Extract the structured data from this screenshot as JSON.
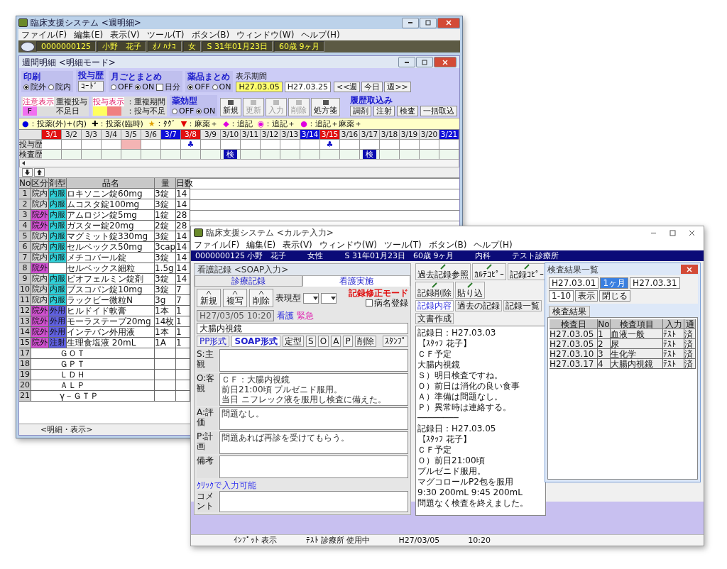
{
  "back_window": {
    "title": "臨床支援システム <週明細>",
    "menu": [
      "ファイル(F)",
      "編集(E)",
      "表示(V)",
      "ツール(T)",
      "ボタン(B)",
      "ウィンドウ(W)",
      "ヘルプ(H)"
    ],
    "patient_bar": [
      "0000000125",
      "小野　花子",
      "ｵﾉ ﾊﾅｺ",
      "女",
      "S 31年01月23日",
      "60歳 9ヶ月"
    ],
    "sub_window": {
      "title": "週間明細 <明細モード>",
      "print_group": {
        "heading": "印刷",
        "options": [
          {
            "label": "院外",
            "selected": true
          },
          {
            "label": "院内",
            "selected": false
          }
        ]
      },
      "dose_group": {
        "heading": "投与歴",
        "button": "ｺｰﾄﾞ"
      },
      "month_group": {
        "heading": "月ごとまとめ",
        "options": [
          {
            "label": "OFF",
            "selected": false
          },
          {
            "label": "ON",
            "selected": true
          }
        ],
        "check": {
          "label": "日分",
          "checked": false
        }
      },
      "drug_group": {
        "heading": "薬品まとめ",
        "options": [
          {
            "label": "OFF",
            "selected": true
          },
          {
            "label": "ON",
            "selected": false
          }
        ]
      },
      "type_group": {
        "heading": "薬効型",
        "options": [
          {
            "label": "OFF",
            "selected": false
          },
          {
            "label": "ON",
            "selected": true
          }
        ]
      },
      "notes": [
        {
          "tag": "注意表示",
          "lines": [
            "重複投与",
            "不足日"
          ],
          "swatches": [
            {
              "label": "F",
              "color": "#f070f0"
            }
          ]
        },
        {
          "tag": "投与表示",
          "lines": [
            "：重複期間",
            "：投与不足"
          ],
          "swatches": [
            {
              "color": "#ffff60"
            },
            {
              "color": "#f08080"
            }
          ]
        }
      ],
      "period": {
        "label": "表示期間",
        "from": "H27.03.05",
        "to": "H27.03.25",
        "nav": [
          "<<週",
          "今日",
          "週>>"
        ]
      },
      "tools": [
        {
          "label": "新規",
          "disabled": false
        },
        {
          "label": "更新",
          "disabled": true
        },
        {
          "label": "入力",
          "disabled": true
        },
        {
          "label": "削除",
          "disabled": true
        },
        {
          "label": "処方箋",
          "disabled": false
        }
      ],
      "history": {
        "heading": "履歴取込み",
        "buttons": [
          "調剤",
          "注射",
          "検査"
        ],
        "all": "一括取込"
      },
      "legend": [
        {
          "symbol": "●",
          "text": "：投薬(外)+(内)",
          "color": "#0000e0"
        },
        {
          "symbol": "✚",
          "text": "：投薬(臨時)",
          "color": "#000000"
        },
        {
          "symbol": "★",
          "text": "：ﾀｸﾞ",
          "color": "#e0a000"
        },
        {
          "symbol": "▼",
          "text": "：麻薬＋",
          "color": "#e00000"
        },
        {
          "symbol": "◆",
          "text": "：追記",
          "color": "#e000e0"
        },
        {
          "symbol": "◉",
          "text": "：追記＋",
          "color": "#e000e0"
        },
        {
          "symbol": "●",
          "text": "：追記＋麻薬＋",
          "color": "#e000e0"
        }
      ],
      "row_labels": [
        "投与歴",
        "検査歴"
      ],
      "days": [
        {
          "label": "3/1",
          "kind": "sun",
          "selected": false
        },
        {
          "label": "3/2",
          "kind": "day",
          "selected": false
        },
        {
          "label": "3/3",
          "kind": "day",
          "selected": false
        },
        {
          "label": "3/4",
          "kind": "day",
          "selected": false
        },
        {
          "label": "3/5",
          "kind": "day",
          "selected": true
        },
        {
          "label": "3/6",
          "kind": "day",
          "selected": false
        },
        {
          "label": "3/7",
          "kind": "sat",
          "selected": false
        },
        {
          "label": "3/8",
          "kind": "sun",
          "selected": false,
          "dose": "♣"
        },
        {
          "label": "3/9",
          "kind": "day",
          "selected": false
        },
        {
          "label": "3/10",
          "kind": "day",
          "selected": false,
          "lab": "検"
        },
        {
          "label": "3/11",
          "kind": "day",
          "selected": false
        },
        {
          "label": "3/12",
          "kind": "day",
          "selected": false
        },
        {
          "label": "3/13",
          "kind": "day",
          "selected": false
        },
        {
          "label": "3/14",
          "kind": "sat",
          "selected": false
        },
        {
          "label": "3/15",
          "kind": "sun",
          "selected": false,
          "dose": "♣"
        },
        {
          "label": "3/16",
          "kind": "day",
          "selected": false
        },
        {
          "label": "3/17",
          "kind": "day",
          "selected": false,
          "lab": "検"
        },
        {
          "label": "3/18",
          "kind": "day",
          "selected": false
        },
        {
          "label": "3/19",
          "kind": "day",
          "selected": false
        },
        {
          "label": "3/20",
          "kind": "day",
          "selected": false
        },
        {
          "label": "3/21",
          "kind": "sat",
          "selected": false
        }
      ],
      "columns": [
        "No",
        "区分",
        "剤型",
        "品名",
        "量",
        "日数"
      ],
      "rows": [
        {
          "no": "1",
          "division": {
            "label": "院内",
            "color": "#d8d8d8"
          },
          "form": {
            "label": "内服",
            "color": "#30d0d8"
          },
          "name": "ロキソニン錠60mg",
          "amount": "3錠",
          "days": "14"
        },
        {
          "no": "2",
          "division": {
            "label": "院内",
            "color": "#d8d8d8"
          },
          "form": {
            "label": "内服",
            "color": "#30d0d8"
          },
          "name": "ムコスタ錠100mg",
          "amount": "3錠",
          "days": "14"
        },
        {
          "no": "3",
          "division": {
            "label": "院外",
            "color": "#d050d0"
          },
          "form": {
            "label": "内服",
            "color": "#30d0d8"
          },
          "name": "アムロジン錠5mg",
          "amount": "1錠",
          "days": "28"
        },
        {
          "no": "4",
          "division": {
            "label": "院外",
            "color": "#d050d0"
          },
          "form": {
            "label": "内服",
            "color": "#30d0d8"
          },
          "name": "ガスター錠20mg",
          "amount": "2錠",
          "days": "28"
        },
        {
          "no": "5",
          "division": {
            "label": "院内",
            "color": "#d8d8d8"
          },
          "form": {
            "label": "内服",
            "color": "#30d0d8"
          },
          "name": "マグミット錠330mg",
          "amount": "3錠",
          "days": "14"
        },
        {
          "no": "6",
          "division": {
            "label": "院内",
            "color": "#d8d8d8"
          },
          "form": {
            "label": "内服",
            "color": "#30d0d8"
          },
          "name": "セルベックス50mg",
          "amount": "3cap",
          "days": "14"
        },
        {
          "no": "7",
          "division": {
            "label": "院内",
            "color": "#d8d8d8"
          },
          "form": {
            "label": "内服",
            "color": "#30d0d8"
          },
          "name": "メチコバール錠",
          "amount": "3錠",
          "days": "14"
        },
        {
          "no": "8",
          "division": {
            "label": "院外",
            "color": "#d050d0"
          },
          "name": "セルベックス細粒",
          "amount": "1.5g",
          "days": "14"
        },
        {
          "no": "9",
          "division": {
            "label": "院内",
            "color": "#d8d8d8"
          },
          "form": {
            "label": "内服",
            "color": "#30d0d8"
          },
          "name": "ビオフェルミン錠剤",
          "amount": "3錠",
          "days": "14"
        },
        {
          "no": "10",
          "division": {
            "label": "院内",
            "color": "#d8d8d8"
          },
          "form": {
            "label": "内服",
            "color": "#30d0d8"
          },
          "name": "ブスコパン錠10mg",
          "amount": "3錠",
          "days": "7"
        },
        {
          "no": "11",
          "division": {
            "label": "院内",
            "color": "#d8d8d8"
          },
          "form": {
            "label": "内服",
            "color": "#30d0d8"
          },
          "name": "ラックビー微粒N",
          "amount": "3g",
          "days": "7"
        },
        {
          "no": "12",
          "division": {
            "label": "院外",
            "color": "#d050d0"
          },
          "form": {
            "label": "外用",
            "color": "#6060e0"
          },
          "name": "ヒルドイド軟膏",
          "amount": "1本",
          "days": "1"
        },
        {
          "no": "13",
          "division": {
            "label": "院外",
            "color": "#d050d0"
          },
          "form": {
            "label": "外用",
            "color": "#6060e0"
          },
          "name": "モーラステープ20mg",
          "amount": "14枚",
          "days": "1"
        },
        {
          "no": "14",
          "division": {
            "label": "院外",
            "color": "#d050d0"
          },
          "form": {
            "label": "外用",
            "color": "#6060e0"
          },
          "name": "インテバン外用液",
          "amount": "1本",
          "days": "1"
        },
        {
          "no": "15",
          "division": {
            "label": "院外",
            "color": "#d050d0"
          },
          "form": {
            "label": "注射",
            "color": "#6060e0"
          },
          "name": "生理食塩液 20mL",
          "amount": "1A",
          "days": "1"
        }
      ],
      "lab_rows": [
        {
          "no": "17",
          "name": "ＧＯＴ"
        },
        {
          "no": "18",
          "name": "ＧＰＴ"
        },
        {
          "no": "19",
          "name": "ＬＤＨ"
        },
        {
          "no": "20",
          "name": "ＡＬＰ"
        },
        {
          "no": "21",
          "name": "γ－ＧＴＰ"
        }
      ],
      "status": "<明細・表示>"
    }
  },
  "front_window": {
    "title": "臨床支援システム <カルテ入力>",
    "menu": [
      "ファイル(F)",
      "編集(E)",
      "表示(V)",
      "ウィンドウ(W)",
      "ツール(T)",
      "ボタン(B)",
      "ヘルプ(H)"
    ],
    "patient_bar": [
      "0000000125 小野　花子",
      "女性",
      "S 31年01月23日　60歳 9ヶ月",
      "内科",
      "テスト診療所"
    ],
    "editor": {
      "title": "看護記録 <SOAP入力>",
      "tabs": [
        {
          "label": "診療記録",
          "selected": false
        },
        {
          "label": "看護実施",
          "selected": true
        }
      ],
      "buttons": [
        "新規",
        "複写",
        "削除"
      ],
      "type_label": "表現型",
      "mode_label": "記録修正モード",
      "register": {
        "label": "病名登録",
        "checked": false
      },
      "datetime": "H27/03/05 10:20",
      "staff": "看護",
      "urgent": "緊急",
      "problem": "大腸内視鏡",
      "formats": [
        {
          "label": "PP形式",
          "selected": false
        },
        {
          "label": "SOAP形式",
          "selected": true
        }
      ],
      "format_buttons": [
        "定型",
        "S",
        "O",
        "A",
        "P",
        "削除"
      ],
      "stamp": "ｽﾀﾝﾌﾟ",
      "sections": [
        {
          "label": "S:主観"
        },
        {
          "label": "O:客観",
          "lines": [
            "ＣＦ：大腸内視鏡",
            "前日21:00頃 プルゼニド服用。",
            "当日 ニフレック液を服用し検査に備えた。"
          ]
        },
        {
          "label": "A:評価",
          "lines": [
            "問題なし。"
          ]
        },
        {
          "label": "P:計画",
          "lines": [
            "問題あれば再診を受けてもらう。"
          ]
        },
        {
          "label": "備考"
        }
      ],
      "comment_hint": "ｸﾘｯｸで入力可能",
      "comment_label": "コメント"
    },
    "log": {
      "tools": [
        "過去記録参照",
        "ｶﾙﾃｺﾋﾟｰ",
        "記録ｺﾋﾟｰ",
        "記録削除",
        "貼り込"
      ],
      "tabs": [
        {
          "label": "記録内容",
          "selected": true
        },
        {
          "label": "過去の記録",
          "selected": false
        },
        {
          "label": "記録一覧",
          "selected": false
        }
      ],
      "side_button": "文書作成",
      "lines": [
        "記録日：H27.03.03",
        "【ｽﾀｯﾌ 花子】",
        "ＣＦ予定",
        "大腸内視鏡",
        "Ｓ）明日検査ですね。",
        "Ｏ）前日は消化の良い食事",
        "Ａ）準備は問題なし。",
        "Ｐ）異常時は連絡する。",
        "────────",
        "記録日：H27.03.05",
        "【ｽﾀｯﾌ 花子】",
        "ＣＦ予定",
        "Ｏ）前日21:00頃",
        "プルゼニド服用。",
        "マグコロールP2包を服用",
        "9:30 200mL 9:45 200mL",
        "問題なく検査を終えました。"
      ]
    },
    "results": {
      "title": "検査結果一覧",
      "from": "H27.03.01",
      "unit": "1ヶ月",
      "to": "H27.03.31",
      "range": "1-10",
      "buttons": [
        "表示",
        "閉じる"
      ],
      "tab": "検査結果",
      "columns": [
        "検査日",
        "No",
        "検査項目",
        "入力",
        "通"
      ],
      "rows": [
        [
          "H27.03.05",
          "1",
          "血液一般",
          "ﾃｽﾄ",
          "済"
        ],
        [
          "H27.03.05",
          "2",
          "尿",
          "ﾃｽﾄ",
          "済"
        ],
        [
          "H27.03.10",
          "3",
          "生化学",
          "ﾃｽﾄ",
          "済"
        ],
        [
          "H27.03.17",
          "4",
          "大腸内視鏡",
          "ﾃｽﾄ",
          "済"
        ]
      ]
    },
    "status_bar": [
      "ｲﾝﾌﾟｯﾄ 表示",
      "ﾃｽﾄ 診療所 使用中",
      "H27/03/05",
      "10:20"
    ]
  }
}
